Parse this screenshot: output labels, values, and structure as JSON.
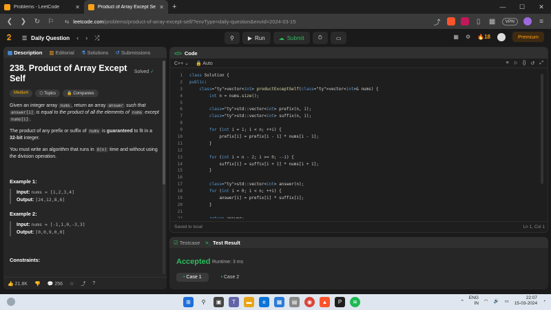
{
  "browser": {
    "tabs": [
      {
        "title": "Problems - LeetCode"
      },
      {
        "title": "Product of Array Except Self - Le"
      }
    ],
    "url_host": "leetcode.com",
    "url_rest": "/problems/product-of-array-except-self/?envType=daily-question&envId=2024-03-15",
    "vpn_label": "VPN"
  },
  "lc_nav": {
    "section": "Daily Question",
    "run_label": "Run",
    "submit_label": "Submit",
    "streak": "18",
    "premium_label": "Premium"
  },
  "problem": {
    "tabs": [
      "Description",
      "Editorial",
      "Solutions",
      "Submissions"
    ],
    "title": "238. Product of Array Except Self",
    "solved_label": "Solved",
    "tags": [
      "Medium",
      "Topics",
      "Companies"
    ],
    "desc1_a": "Given an integer array",
    "desc1_nums": "nums",
    "desc1_b": ", return an array",
    "desc1_answer": "answer",
    "desc1_c": "such that",
    "desc1_answer_i": "answer[i]",
    "desc1_d": "is equal to the product of all the elements of",
    "desc1_nums2": "nums",
    "desc1_e": "except",
    "desc1_nums_i": "nums[i]",
    "desc1_f": ".",
    "desc2_a": "The product of any prefix or suffix of",
    "desc2_nums": "nums",
    "desc2_b": "is",
    "desc2_guaranteed": "guaranteed",
    "desc2_c": "to fit in a",
    "desc2_bit": "32-bit",
    "desc2_d": "integer.",
    "desc3_a": "You must write an algorithm that runs in",
    "desc3_on": "O(n)",
    "desc3_b": "time and without using the division operation.",
    "example1_title": "Example 1:",
    "example1_input_label": "Input:",
    "example1_input": "nums = [1,2,3,4]",
    "example1_output_label": "Output:",
    "example1_output": "[24,12,8,6]",
    "example2_title": "Example 2:",
    "example2_input_label": "Input:",
    "example2_input": "nums = [-1,1,0,-3,3]",
    "example2_output_label": "Output:",
    "example2_output": "[0,0,9,0,0]",
    "constraints_title": "Constraints:",
    "likes": "21.8K",
    "comments": "256"
  },
  "code": {
    "header": "Code",
    "language": "C++",
    "mode": "Auto",
    "lines": [
      "class Solution {",
      "public:",
      "    vector<int> productExceptSelf(vector<int>& nums) {",
      "        int n = nums.size();",
      "",
      "        std::vector<int> prefix(n, 1);",
      "        std::vector<int> suffix(n, 1);",
      "",
      "        for (int i = 1; i < n; ++i) {",
      "            prefix[i] = prefix[i - 1] * nums[i - 1];",
      "        }",
      "",
      "        for (int i = n - 2; i >= 0; --i) {",
      "            suffix[i] = suffix[i + 1] * nums[i + 1];",
      "        }",
      "",
      "        std::vector<int> answer(n);",
      "        for (int i = 0; i < n; ++i) {",
      "            answer[i] = prefix[i] * suffix[i];",
      "        }",
      "",
      "        return answer;",
      "    }"
    ],
    "saved_label": "Saved to local",
    "cursor": "Ln 1, Col 1"
  },
  "result": {
    "tab_testcase": "Testcase",
    "tab_result": "Test Result",
    "status": "Accepted",
    "runtime": "Runtime: 3 ms",
    "cases": [
      "Case 1",
      "Case 2"
    ]
  },
  "taskbar": {
    "lang": "ENG",
    "region": "IN",
    "time": "22:07",
    "date": "15-03-2024"
  }
}
